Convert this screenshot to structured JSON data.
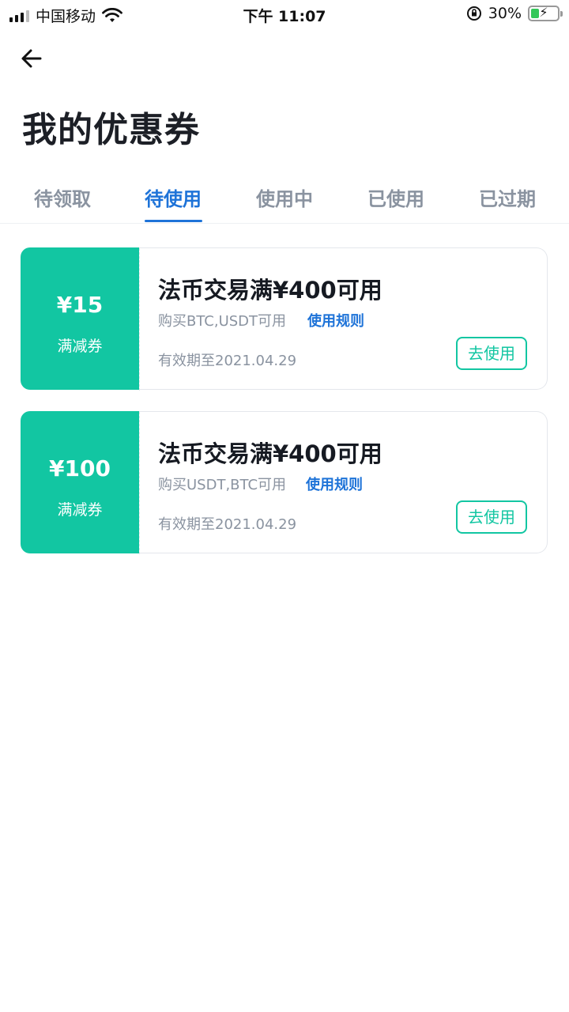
{
  "status_bar": {
    "carrier": "中国移动",
    "time": "下午 11:07",
    "battery_percent": "30%",
    "battery_level": 0.3
  },
  "header": {
    "back_icon": "arrow-left-icon",
    "title": "我的优惠券"
  },
  "tabs": [
    {
      "label": "待领取"
    },
    {
      "label": "待使用",
      "active": true
    },
    {
      "label": "使用中"
    },
    {
      "label": "已使用"
    },
    {
      "label": "已过期"
    }
  ],
  "coupons": [
    {
      "amount": "¥15",
      "type": "满减券",
      "title": "法币交易满¥400可用",
      "desc": "购买BTC,USDT可用",
      "rules_label": "使用规则",
      "expiry": "有效期至2021.04.29",
      "button": "去使用"
    },
    {
      "amount": "¥100",
      "type": "满减券",
      "title": "法币交易满¥400可用",
      "desc": "购买USDT,BTC可用",
      "rules_label": "使用规则",
      "expiry": "有效期至2021.04.29",
      "button": "去使用"
    }
  ],
  "colors": {
    "accent_blue": "#1e73d8",
    "coupon_green": "#12c6a2"
  }
}
